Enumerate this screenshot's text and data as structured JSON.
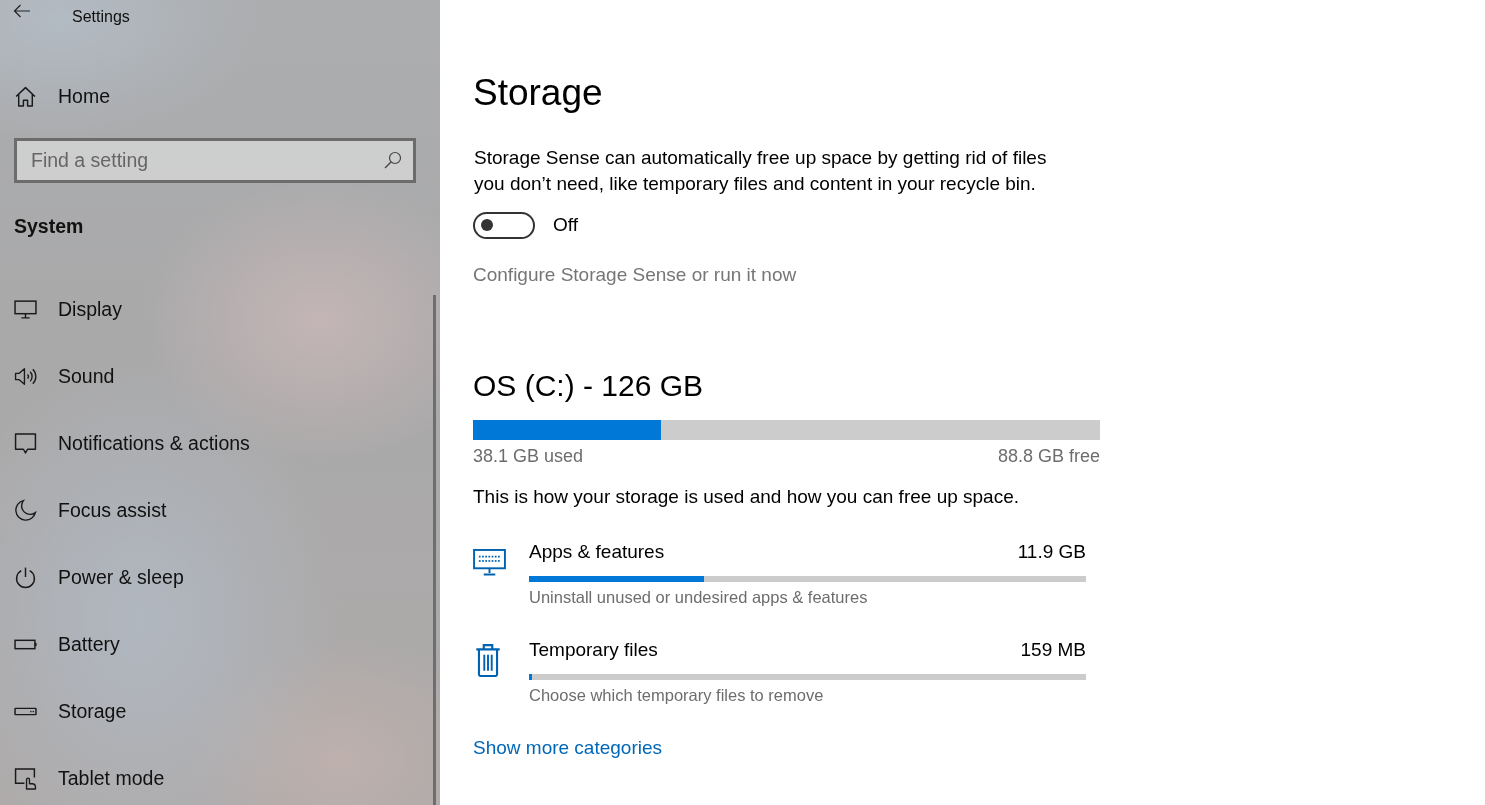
{
  "window": {
    "title": "Settings"
  },
  "sidebar": {
    "home": {
      "label": "Home"
    },
    "search": {
      "placeholder": "Find a setting"
    },
    "section": "System",
    "items": [
      {
        "kind": "display",
        "label": "Display"
      },
      {
        "kind": "sound",
        "label": "Sound"
      },
      {
        "kind": "notifications",
        "label": "Notifications & actions"
      },
      {
        "kind": "focus",
        "label": "Focus assist"
      },
      {
        "kind": "power",
        "label": "Power & sleep"
      },
      {
        "kind": "battery",
        "label": "Battery"
      },
      {
        "kind": "storage",
        "label": "Storage"
      },
      {
        "kind": "tablet",
        "label": "Tablet mode"
      }
    ]
  },
  "page": {
    "title": "Storage",
    "description": "Storage Sense can automatically free up space by getting rid of files you don’t need, like temporary files and content in your recycle bin.",
    "toggle": {
      "on": false,
      "label": "Off"
    },
    "link": {
      "label": "Configure Storage Sense or run it now",
      "disabled": true
    }
  },
  "drive": {
    "title": "OS (C:) - 126 GB",
    "level": 0.3,
    "used": "38.1 GB used",
    "free": "88.8 GB free",
    "summary": "This is how your storage is used and how you can free up space.",
    "categories": [
      {
        "kind": "apps",
        "name": "Apps & features",
        "size": "11.9 GB",
        "level": 0.314,
        "hint": "Uninstall unused or undesired apps & features"
      },
      {
        "kind": "temp",
        "name": "Temporary files",
        "size": "159 MB",
        "level": 0.005,
        "hint": "Choose which temporary files to remove"
      }
    ],
    "more_link": "Show more categories"
  }
}
